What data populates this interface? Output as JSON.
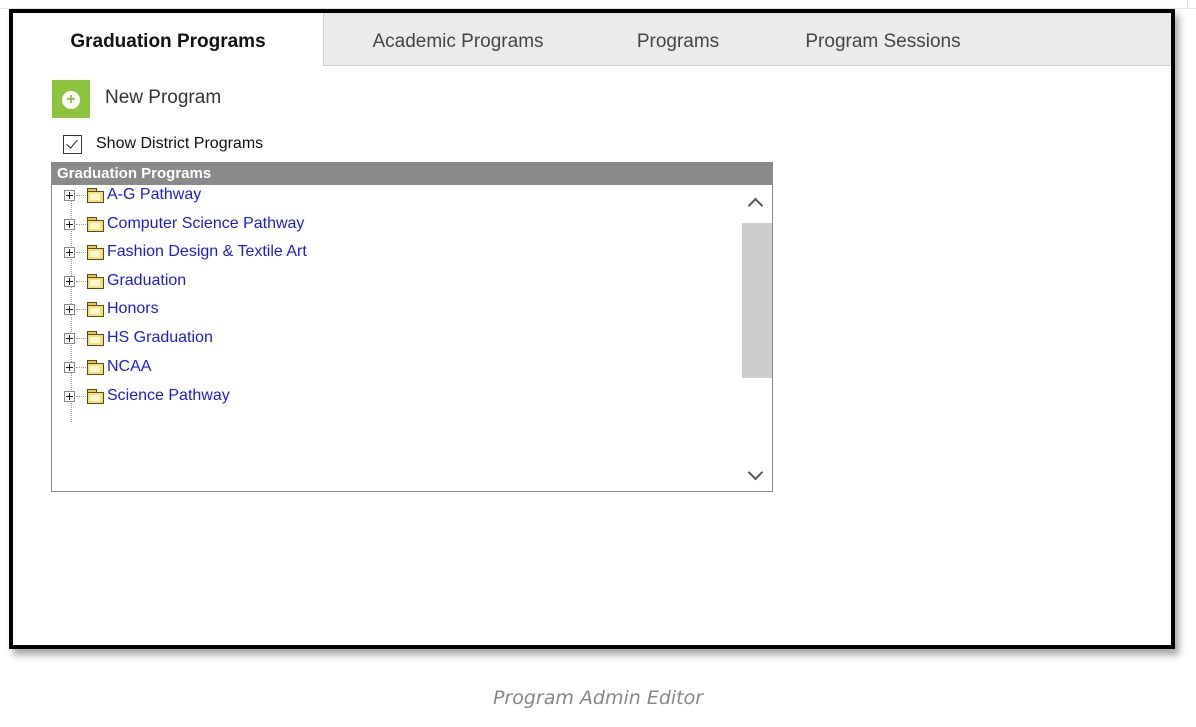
{
  "tabs": [
    {
      "label": "Graduation Programs",
      "active": true
    },
    {
      "label": "Academic Programs",
      "active": false
    },
    {
      "label": "Programs",
      "active": false
    },
    {
      "label": "Program Sessions",
      "active": false
    }
  ],
  "toolbar": {
    "new_label": "New Program",
    "new_icon": "plus-circle-icon",
    "accent": "#8cc43c"
  },
  "filter": {
    "show_district_label": "Show District Programs",
    "show_district_checked": true
  },
  "panel": {
    "title": "Graduation Programs",
    "header_color": "#8a8a8a",
    "link_color": "#1a1ae6",
    "items": [
      {
        "label": "A-G Pathway",
        "icon": "folder-icon"
      },
      {
        "label": "Computer Science Pathway",
        "icon": "folder-icon"
      },
      {
        "label": "Fashion Design & Textile Art",
        "icon": "folder-icon"
      },
      {
        "label": "Graduation",
        "icon": "folder-icon"
      },
      {
        "label": "Honors",
        "icon": "folder-icon"
      },
      {
        "label": "HS Graduation",
        "icon": "folder-icon"
      },
      {
        "label": "NCAA",
        "icon": "folder-icon"
      },
      {
        "label": "Science Pathway",
        "icon": "folder-icon"
      }
    ]
  },
  "caption": "Program Admin Editor"
}
